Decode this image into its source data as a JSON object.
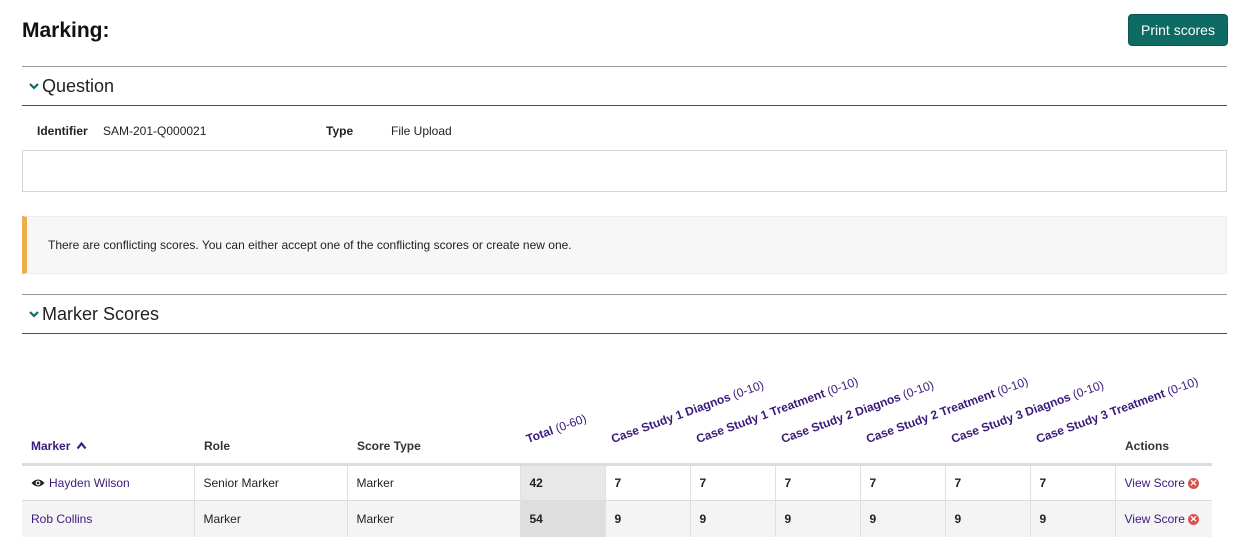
{
  "page": {
    "title": "Marking:",
    "print_label": "Print scores"
  },
  "question": {
    "header": "Question",
    "identifier_label": "Identifier",
    "identifier_value": "SAM-201-Q000021",
    "type_label": "Type",
    "type_value": "File Upload"
  },
  "alert": {
    "text": "There are conflicting scores. You can either accept one of the conflicting scores or create new one.",
    "color": "#f0ad4e"
  },
  "marker_scores": {
    "header": "Marker Scores",
    "columns": {
      "marker": "Marker",
      "role": "Role",
      "score_type": "Score Type",
      "actions": "Actions"
    },
    "criteria": [
      {
        "name": "Total",
        "range": "(0-60)"
      },
      {
        "name": "Case Study 1 Diagnos",
        "range": "(0-10)"
      },
      {
        "name": "Case Study 1 Treatment",
        "range": "(0-10)"
      },
      {
        "name": "Case Study 2 Diagnos",
        "range": "(0-10)"
      },
      {
        "name": "Case Study 2 Treatment",
        "range": "(0-10)"
      },
      {
        "name": "Case Study 3 Diagnos",
        "range": "(0-10)"
      },
      {
        "name": "Case Study 3 Treatment",
        "range": "(0-10)"
      }
    ],
    "rows": [
      {
        "marker": "Hayden Wilson",
        "role": "Senior Marker",
        "score_type": "Marker",
        "total": "42",
        "s1": "7",
        "s2": "7",
        "s3": "7",
        "s4": "7",
        "s5": "7",
        "s6": "7",
        "action": "View Score"
      },
      {
        "marker": "Rob Collins",
        "role": "Marker",
        "score_type": "Marker",
        "total": "54",
        "s1": "9",
        "s2": "9",
        "s3": "9",
        "s4": "9",
        "s5": "9",
        "s6": "9",
        "action": "View Score"
      }
    ]
  },
  "colors": {
    "accent": "#0d6b63",
    "link": "#3b1a7a",
    "danger": "#d9534f"
  }
}
